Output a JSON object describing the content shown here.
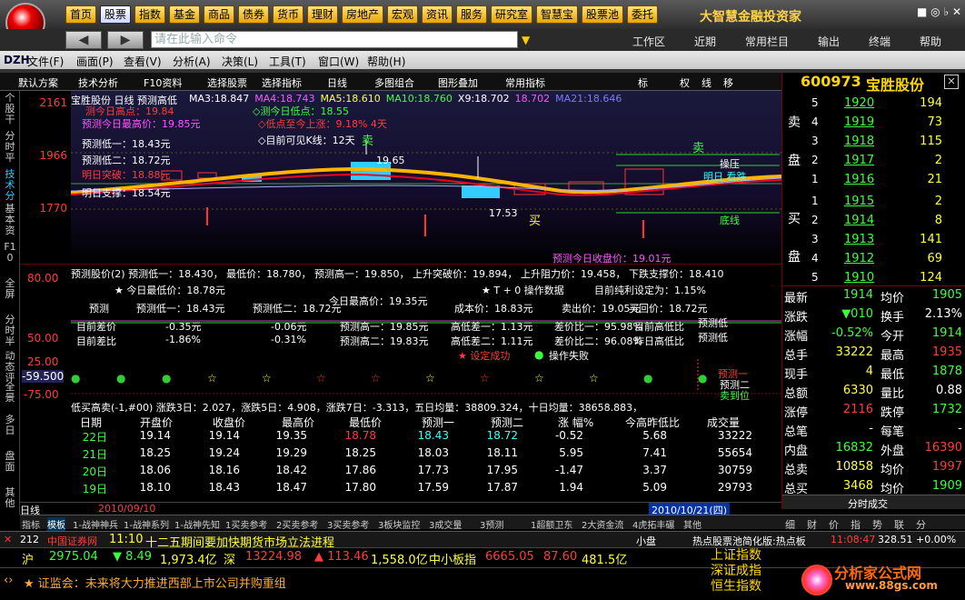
{
  "nav": [
    "首页",
    "股票",
    "指数",
    "基金",
    "商品",
    "债券",
    "货币",
    "理财",
    "房地产",
    "宏观",
    "资讯",
    "服务",
    "研究室",
    "智慧宝",
    "股票池",
    "委托"
  ],
  "brand": "大智慧金融投资家",
  "window_controls": "■ ◎ ♭ ✕",
  "cmd": {
    "placeholder": "请在此输入命令",
    "items": [
      "工作区",
      "近期",
      "常用栏目",
      "输出",
      "终端",
      "帮助"
    ]
  },
  "menu": [
    "文件(F)",
    "画面(P)",
    "查看(V)",
    "分析(A)",
    "决策(L)",
    "工具(T)",
    "窗口(W)",
    "帮助(H)"
  ],
  "subbar": [
    "默认方案",
    "技术分析",
    "F10资料",
    "选择股票",
    "选择指标",
    "日线",
    "多图组合",
    "图形叠加",
    "常用指标",
    "标",
    "权",
    "线",
    "移"
  ],
  "vtabs": [
    "个股干",
    "分时平",
    "技术分",
    "基本资",
    "F10",
    "全屏",
    "分时半",
    "动态评",
    "全景",
    "多日",
    "盘面",
    "其他"
  ],
  "stock": {
    "code": "600973",
    "name": "宝胜股份"
  },
  "chart1": {
    "title": "宝胜股份 日线 预测高低",
    "ma": [
      {
        "k": "MA3:",
        "v": "18.847"
      },
      {
        "k": "MA4:",
        "v": "18.743"
      },
      {
        "k": "MA5:",
        "v": "18.610"
      },
      {
        "k": "MA10:",
        "v": "18.760"
      },
      {
        "k": "X9:",
        "v": "18.702"
      },
      {
        "k": "",
        "v": "18.702"
      },
      {
        "k": "MA21:",
        "v": "18.646"
      }
    ],
    "ticks": [
      "2161",
      "1966",
      "1770"
    ],
    "notes": {
      "a": "测今日高点：19.84",
      "b": "预测今日最高价：19.85元",
      "c": "预测低一：18.43元",
      "d": "预测低二：18.72元",
      "e": "明日突破：18.88元",
      "f": "明日支撑：18.54元",
      "g": "◇测今日低点：18.55",
      "h": "◇低点至今上涨：9.18%  4天",
      "i": "◇目前可见K线：12天",
      "j": "19.65",
      "k": "17.53",
      "l": "买",
      "m": "卖",
      "n": "操压",
      "o": "明日 看跌",
      "p": "底线",
      "q": "预测今日收盘价：19.01元"
    }
  },
  "ind2": {
    "header": "预测股价(2)  预测低一：18.430， 最低价：18.780， 预测高一：19.850， 上升突破价：19.894， 上升阻力价：19.458， 下跌支撑价：18.410",
    "ticks": [
      "80.00",
      "50.00",
      "25.00",
      "-59.500",
      "-75.00"
    ],
    "r1": {
      "a": "★ 今日最低价：18.78元",
      "b": "今日最高价：19.35元",
      "c": "★ T + 0 操作数据",
      "d": "目前纯利设定为：1.15%"
    },
    "r2": {
      "a": "预测",
      "b": "预测低一：18.43元",
      "c": "预测低二：18.72元",
      "d": "成本价：18.83元",
      "e": "卖出价：19.05元",
      "f": "买回价：18.72元"
    },
    "r3": {
      "a": "目前差价",
      "b": "-0.35元",
      "c": "-0.06元",
      "d": "预测高一：19.85元",
      "e": "高低差一：1.13元",
      "f": "差价比一：95.98%",
      "g": "目前高低比",
      "h": "预测低"
    },
    "r4": {
      "a": "目前差比",
      "b": "-1.86%",
      "c": "-0.31%",
      "d": "预测高二：19.83元",
      "e": "高低差二：1.11元",
      "f": "差价比二：96.08%",
      "g": "昨日高低比",
      "h": "预测低"
    },
    "r5": {
      "a": "★ 设定成功",
      "b": "操作失败"
    },
    "labels": [
      "预测一",
      "预测二",
      "卖到位"
    ]
  },
  "table": {
    "header_line": "低买高卖(-1,#00)  涨跌3日：2.027，涨跌5日：4.908，涨跌7日：-3.313，五日均量：38809.324，十日均量：38658.883，",
    "cols": [
      "日期",
      "开盘价",
      "收盘价",
      "最高价",
      "最低价",
      "预测一",
      "预测二",
      "涨 幅%",
      "今高昨低比",
      "成交量"
    ],
    "rows": [
      [
        "22日",
        "19.14",
        "19.14",
        "19.35",
        "18.78",
        "18.43",
        "18.72",
        "-0.52",
        "5.68",
        "33222"
      ],
      [
        "21日",
        "18.25",
        "19.24",
        "19.29",
        "18.25",
        "18.03",
        "18.11",
        "5.95",
        "7.41",
        "55654"
      ],
      [
        "20日",
        "18.06",
        "18.16",
        "18.42",
        "17.86",
        "17.73",
        "17.95",
        "-1.47",
        "3.37",
        "30759"
      ],
      [
        "19日",
        "18.10",
        "18.43",
        "18.47",
        "17.80",
        "17.59",
        "17.87",
        "1.94",
        "5.09",
        "29793"
      ]
    ],
    "datebar": {
      "period": "日线",
      "left": "2010/09/10",
      "right": "2010/10/21(四)"
    }
  },
  "tabs": [
    "指标",
    "模板",
    "1-战神神兵",
    "1-战神系列",
    "1-战神先知",
    "1买卖参考",
    "2买卖参考",
    "3买卖参考",
    "3板块监控",
    "3成交量",
    "3预测",
    "1超额卫东",
    "2大资金流",
    "4虎拓丰碾",
    "其他"
  ],
  "orderbook": {
    "sell_label": [
      "卖",
      "盘"
    ],
    "buy_label": [
      "买",
      "盘"
    ],
    "sell": [
      [
        "5",
        "1920",
        "194"
      ],
      [
        "4",
        "1919",
        "73"
      ],
      [
        "3",
        "1918",
        "115"
      ],
      [
        "2",
        "1917",
        "2"
      ],
      [
        "1",
        "1916",
        "21"
      ]
    ],
    "buy": [
      [
        "1",
        "1915",
        "2"
      ],
      [
        "2",
        "1914",
        "8"
      ],
      [
        "3",
        "1913",
        "141"
      ],
      [
        "4",
        "1912",
        "69"
      ],
      [
        "5",
        "1910",
        "124"
      ]
    ]
  },
  "quote": [
    [
      "最新",
      "1914",
      "均价",
      "1905"
    ],
    [
      "涨跌",
      "▼010",
      "换手",
      "2.13%"
    ],
    [
      "涨幅",
      "-0.52%",
      "今开",
      "1914"
    ],
    [
      "总手",
      "33222",
      "最高",
      "1935"
    ],
    [
      "现手",
      "4",
      "最低",
      "1878"
    ],
    [
      "总额",
      "6330",
      "量比",
      "0.88"
    ],
    [
      "涨停",
      "2116",
      "跌停",
      "1732"
    ],
    [
      "总笔",
      "-",
      "每笔",
      "-"
    ],
    [
      "内盘",
      "16832",
      "外盘",
      "16390"
    ],
    [
      "总卖",
      "10858",
      "均价",
      "1997"
    ],
    [
      "总买",
      "3468",
      "均价",
      "1909"
    ]
  ],
  "rtabs": [
    "分时成交",
    "细",
    "财",
    "价",
    "指",
    "势",
    "联",
    "分"
  ],
  "ticker": {
    "num": "212",
    "src": "中国证券网",
    "time": "11:10",
    "text": "十二五期间要加快期货市场立法进程",
    "mid": "小盘",
    "right": "热点股票池简化版:热点板",
    "clock": "11:08:47",
    "val": "328.51 +0.00%"
  },
  "indexbar": {
    "sh": "沪",
    "sh_v": "2975.04",
    "sh_c": "▼ 8.49",
    "sh_a": "1,973.4亿",
    "sz": "深",
    "sz_v": "13224.98",
    "sz_c": "▲ 113.46",
    "sz_a": "1,558.0亿",
    "zx": "中小板指",
    "zx_v": "6665.05",
    "zx_c": "87.60",
    "zx_a": "481.5亿"
  },
  "news": "★ 证监会：未来将大力推进西部上市公司并购重组",
  "bright": [
    "上证指数",
    "深证成指",
    "恒生指数"
  ],
  "watermark": {
    "name": "分析家公式网",
    "url": "www.88gs.com"
  }
}
